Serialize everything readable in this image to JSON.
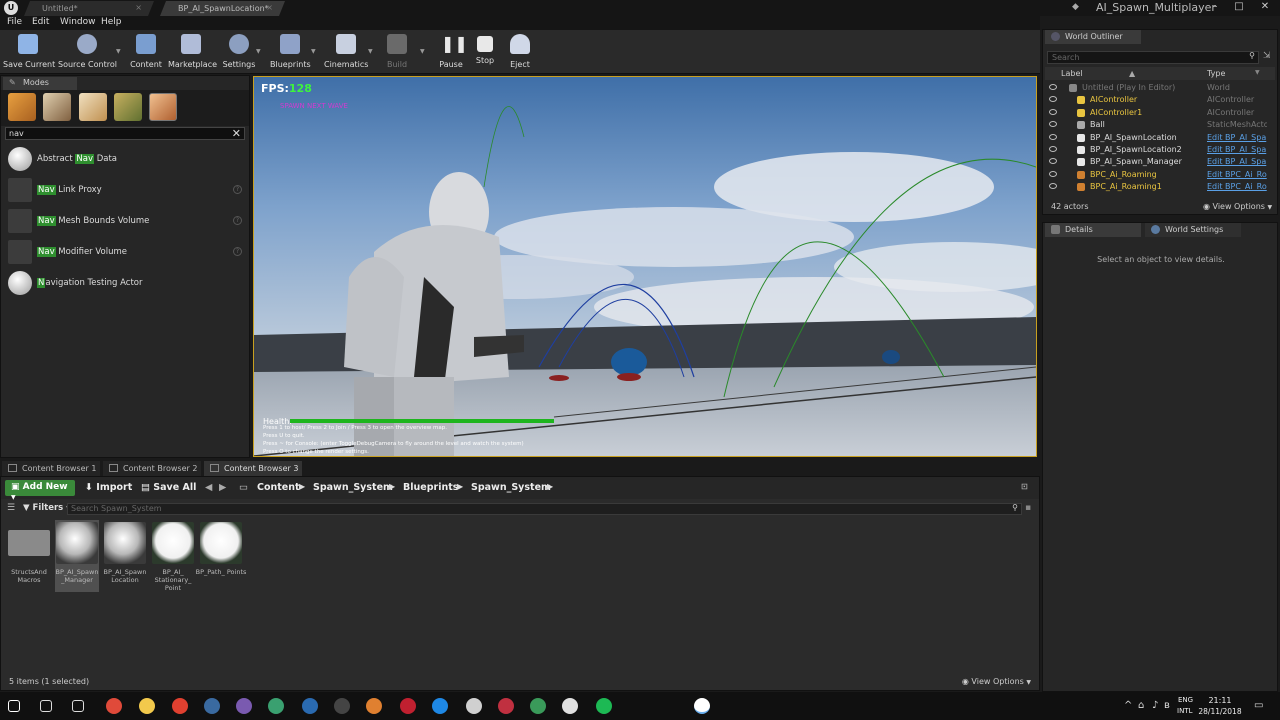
{
  "titlebar": {
    "tabs": [
      "Untitled*",
      "BP_AI_SpawnLocation*"
    ],
    "project": "AI_Spawn_Multiplayer"
  },
  "menu": [
    "File",
    "Edit",
    "Window",
    "Help"
  ],
  "toolbar": [
    {
      "label": "Save Current",
      "icon": "save-icon",
      "color": "#8fb4e6"
    },
    {
      "label": "Source Control",
      "icon": "source-control-icon",
      "color": "#9aaac8"
    },
    {
      "label": "Content",
      "icon": "content-icon",
      "color": "#7a9ed0"
    },
    {
      "label": "Marketplace",
      "icon": "marketplace-icon",
      "color": "#b0bcd8"
    },
    {
      "label": "Settings",
      "icon": "settings-icon",
      "color": "#8c9fc0"
    },
    {
      "label": "Blueprints",
      "icon": "blueprints-icon",
      "color": "#8fa2c8"
    },
    {
      "label": "Cinematics",
      "icon": "cinematics-icon",
      "color": "#c8d0e0"
    },
    {
      "label": "Build",
      "icon": "build-icon",
      "color": "#6a6a6a"
    },
    {
      "label": "Pause",
      "icon": "pause-icon",
      "color": "#e8e8e8"
    },
    {
      "label": "Stop",
      "icon": "stop-icon",
      "color": "#e8e8e8"
    },
    {
      "label": "Eject",
      "icon": "eject-icon",
      "color": "#d0d8e8"
    }
  ],
  "modes": {
    "tab": "Modes",
    "search": "nav",
    "items": [
      {
        "pre": "Abstract ",
        "hl": "Nav",
        "post": " Data",
        "thumb": "sphere",
        "help": false
      },
      {
        "pre": "",
        "hl": "Nav",
        "post": " Link Proxy",
        "thumb": "tool",
        "help": true
      },
      {
        "pre": "",
        "hl": "Nav",
        "post": " Mesh Bounds Volume",
        "thumb": "tool",
        "help": true
      },
      {
        "pre": "",
        "hl": "Nav",
        "post": " Modifier Volume",
        "thumb": "tool",
        "help": true
      },
      {
        "pre": "",
        "hl": "N",
        "post": "avigation Testing Actor",
        "thumb": "sphere",
        "help": false
      }
    ]
  },
  "viewport": {
    "fps_label": "FPS:",
    "fps_value": "128",
    "spawn_text": "SPAWN NEXT WAVE",
    "health_label": "Health:",
    "health_level": 0.58,
    "hints": [
      "Press 1 to host/ Press 2 to Join / Press 3 to open the overview map.",
      "Press U to quit.",
      "Press ~ for Console: (enter ToggleDebugCamera to fly around the level and watch the system)",
      "Press O to change the render settings."
    ]
  },
  "content_browser": {
    "tabs": [
      "Content Browser 1",
      "Content Browser 2",
      "Content Browser 3"
    ],
    "add_new": "Add New",
    "import": "Import",
    "save_all": "Save All",
    "breadcrumbs": [
      "Content",
      "Spawn_System",
      "Blueprints",
      "Spawn_System"
    ],
    "filters": "Filters",
    "search_placeholder": "Search Spawn_System",
    "assets": [
      {
        "label": "StructsAnd Macros",
        "kind": "folder",
        "selected": false
      },
      {
        "label": "BP_AI_Spawn _Manager",
        "kind": "sphere",
        "selected": true
      },
      {
        "label": "BP_AI_Spawn Location",
        "kind": "sphere",
        "selected": false
      },
      {
        "label": "BP_AI_ Stationary_ Point",
        "kind": "white",
        "selected": false
      },
      {
        "label": "BP_Path_ Points",
        "kind": "white",
        "selected": false
      }
    ],
    "item_count": "5 items (1 selected)",
    "view_options": "View Options"
  },
  "outliner": {
    "tab": "World Outliner",
    "search_placeholder": "Search",
    "col_label": "Label",
    "col_type": "Type",
    "rows": [
      {
        "label": "Untitled (Play In Editor)",
        "type": "World",
        "style": "grey",
        "indent": 0,
        "link": false
      },
      {
        "label": "AIController",
        "type": "AIController",
        "style": "yellow",
        "indent": 1,
        "link": false
      },
      {
        "label": "AIController1",
        "type": "AIController",
        "style": "yellow",
        "indent": 1,
        "link": false
      },
      {
        "label": "Ball",
        "type": "StaticMeshActor",
        "style": "normal",
        "indent": 1,
        "link": false
      },
      {
        "label": "BP_AI_SpawnLocation",
        "type": "Edit BP_AI_Spa",
        "style": "normal",
        "indent": 1,
        "link": true
      },
      {
        "label": "BP_AI_SpawnLocation2",
        "type": "Edit BP_AI_Spa",
        "style": "normal",
        "indent": 1,
        "link": true
      },
      {
        "label": "BP_AI_Spawn_Manager",
        "type": "Edit BP_AI_Spa",
        "style": "normal",
        "indent": 1,
        "link": true
      },
      {
        "label": "BPC_Ai_Roaming",
        "type": "Edit BPC_Ai_Ro",
        "style": "yellow",
        "indent": 1,
        "link": true
      },
      {
        "label": "BPC_Ai_Roaming1",
        "type": "Edit BPC_Ai_Ro",
        "style": "yellow",
        "indent": 1,
        "link": true
      }
    ],
    "actors": "42 actors",
    "view_options": "View Options"
  },
  "details": {
    "tab": "Details",
    "tab2": "World Settings",
    "message": "Select an object to view details."
  },
  "taskbar": {
    "apps": [
      "start-icon",
      "search-icon",
      "task-view-icon",
      "chrome-icon",
      "explorer-icon",
      "vivaldi-icon",
      "steam-icon",
      "app-icon",
      "photoshop-icon",
      "epic-icon",
      "app-icon",
      "app-icon",
      "edge-icon",
      "app-icon",
      "app-icon",
      "app-icon",
      "app-icon",
      "app-icon",
      "spotify-icon",
      "unreal-icon"
    ],
    "lang1": "ENG",
    "lang2": "INTL",
    "time": "21:11",
    "date": "28/11/2018"
  }
}
